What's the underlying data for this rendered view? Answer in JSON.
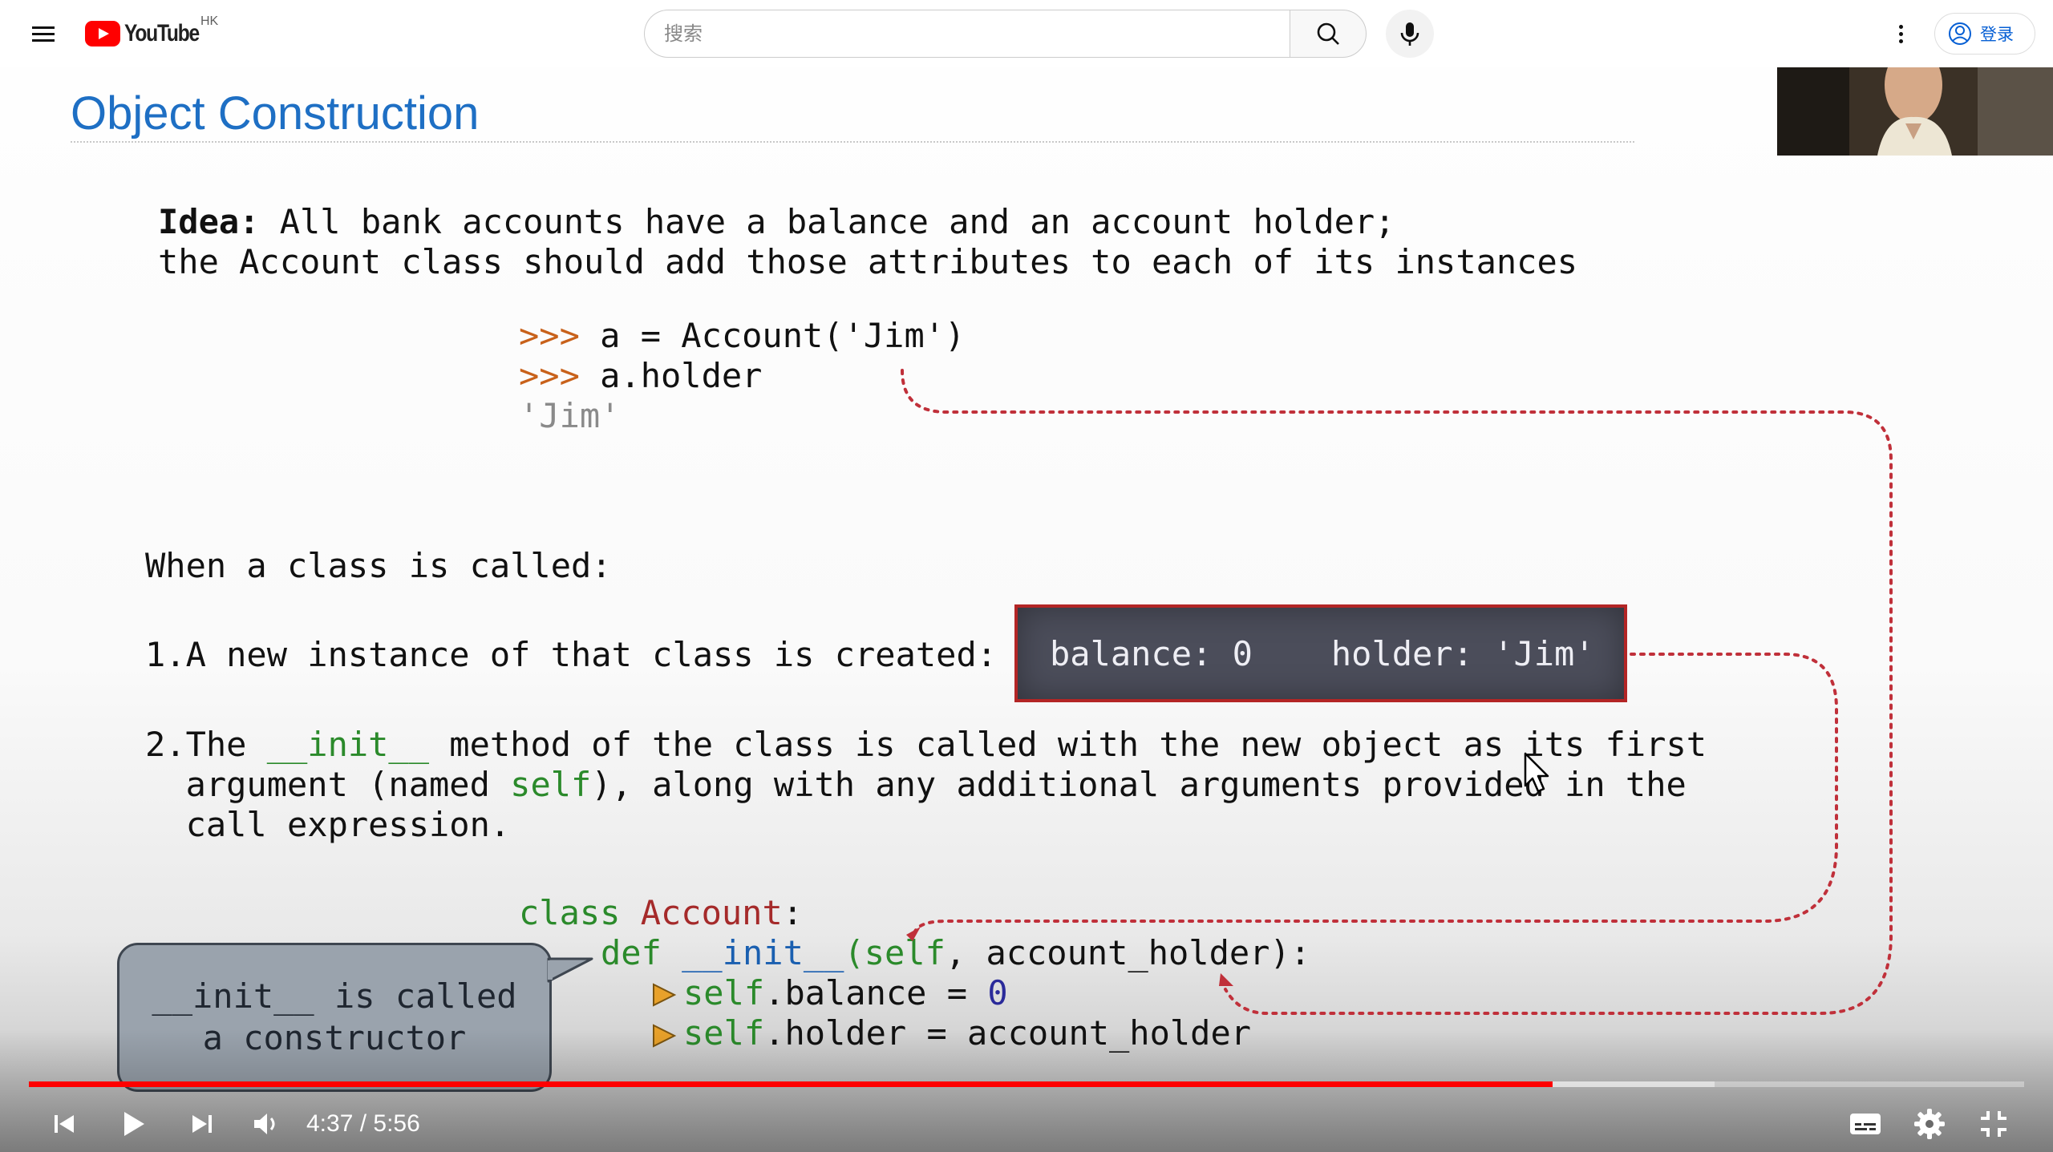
{
  "topbar": {
    "logo_text": "YouTube",
    "region": "HK",
    "search_placeholder": "搜索",
    "signin_label": "登录"
  },
  "slide": {
    "title": "Object Construction",
    "idea_label": "Idea:",
    "idea_line1_rest": " All bank accounts have a balance and an account holder;",
    "idea_line2": "the Account class should add those attributes to each of its instances",
    "repl": {
      "prompt": ">>>",
      "line1": " a = Account('Jim')",
      "line2": " a.holder",
      "output": "'Jim'"
    },
    "when_called": "When a class is called:",
    "step1": "1.A new instance of that class is created:",
    "instance_balance": "balance: 0",
    "instance_holder": "holder: 'Jim'",
    "step2": {
      "prefix": "2.The ",
      "init": "__init__",
      "line1_rest": " method of the class is called with the new object as its first",
      "line2_a": "  argument (named ",
      "self": "self",
      "line2_b": "), along with any additional arguments provided in the",
      "line3": "  call expression."
    },
    "code": {
      "kw_class": "class",
      "class_name": " Account",
      "colon": ":",
      "kw_def": "def",
      "init_name": " __init__",
      "self1": "(self",
      "params_rest": ", account_holder):",
      "self2": "self",
      "balance_stmt": ".balance = ",
      "zero": "0",
      "self3": "self",
      "holder_stmt": ".holder = account_holder"
    },
    "callout_line1": "__init__ is called",
    "callout_line2": "a constructor"
  },
  "player": {
    "time_text": "4:37 / 5:56",
    "progress_played": 0.7635,
    "progress_loaded": 0.845
  }
}
